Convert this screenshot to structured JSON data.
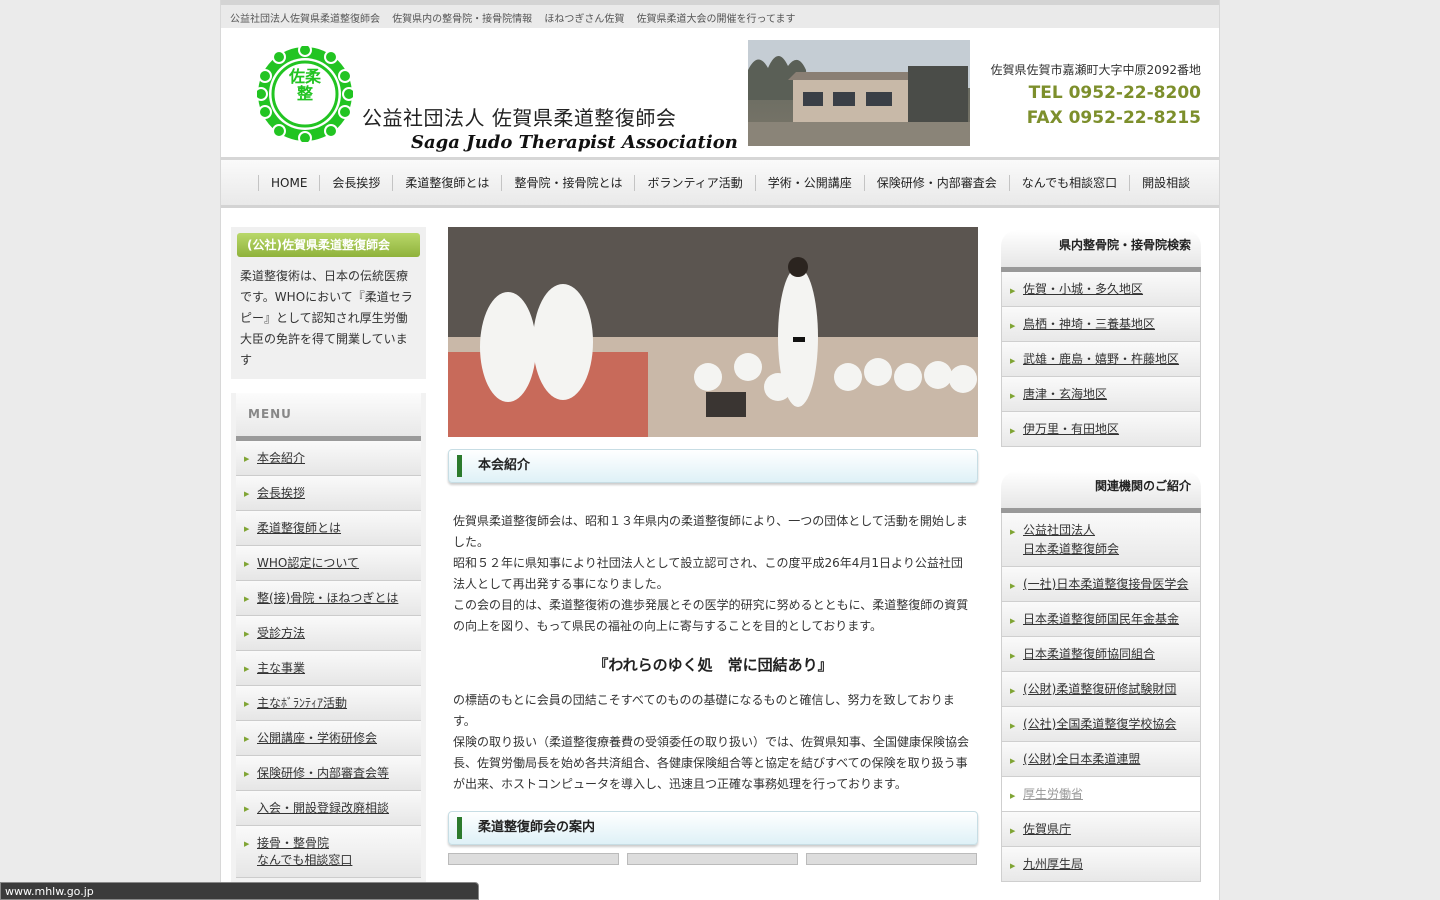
{
  "topbar": {
    "items": [
      "公益社団法人佐賀県柔道整復師会",
      "佐賀県内の整骨院・接骨院情報",
      "ほねつぎさん佐賀",
      "佐賀県柔道大会の開催を行ってます"
    ]
  },
  "header": {
    "emblem_text": "佐柔整",
    "org_name_jp": "公益社団法人 佐賀県柔道整復師会",
    "org_name_en": "Saga Judo Therapist Association",
    "address": "佐賀県佐賀市嘉瀬町大字中原2092番地",
    "tel": "TEL 0952-22-8200",
    "fax": "FAX 0952-22-8215"
  },
  "nav": {
    "items": [
      "HOME",
      "会長挨拶",
      "柔道整復師とは",
      "整骨院・接骨院とは",
      "ボランティア活動",
      "学術・公開講座",
      "保険研修・内部審査会",
      "なんでも相談窓口",
      "開設相談"
    ]
  },
  "sidebar_left": {
    "intro_title": "(公社)佐賀県柔道整復師会",
    "intro_text": "柔道整復術は、日本の伝統医療です。WHOにおいて『柔道セラピー』として認知され厚生労働大臣の免許を得て開業しています",
    "menu_title": "MENU",
    "menu_items": [
      "本会紹介",
      "会長挨拶",
      "柔道整復師とは",
      "WHO認定について",
      "整(接)骨院・ほねつぎとは",
      "受診方法",
      "主な事業",
      "主なﾎﾞﾗﾝﾃｨｱ活動",
      "公開講座・学術研修会",
      "保険研修・内部審査会等",
      "入会・開設登録改廃相談",
      "接骨・整骨院\nなんでも相談窓口"
    ]
  },
  "main": {
    "section1_title": "本会紹介",
    "para1": "佐賀県柔道整復師会は、昭和１３年県内の柔道整復師により、一つの団体として活動を開始しました。",
    "para2": "昭和５２年に県知事により社団法人として設立認可され、この度平成26年4月1日より公益社団法人として再出発する事になりました。",
    "para3": "この会の目的は、柔道整復術の進歩発展とその医学的研究に努めるとともに、柔道整復師の資質の向上を図り、もって県民の福祉の向上に寄与することを目的としております。",
    "motto": "『われらのゆく処　常に団結あり』",
    "para4": "の標語のもとに会員の団結こそすべてのものの基礎になるものと確信し、努力を致しております。",
    "para5": "保険の取り扱い（柔道整復療養費の受領委任の取り扱い）では、佐賀県知事、全国健康保険協会長、佐賀労働局長を始め各共済組合、各健康保険組合等と協定を結びすべての保険を取り扱う事が出来、ホストコンピュータを導入し、迅速且つ正確な事務処理を行っております。",
    "section2_title": "柔道整復師会の案内"
  },
  "sidebar_right": {
    "search_title": "県内整骨院・接骨院検索",
    "search_items": [
      "佐賀・小城・多久地区",
      "鳥栖・神埼・三養基地区",
      "武雄・鹿島・嬉野・杵藤地区",
      "唐津・玄海地区",
      "伊万里・有田地区"
    ],
    "related_title": "関連機関のご紹介",
    "related_items": [
      "公益社団法人\n日本柔道整復師会",
      "(一社)日本柔道整復接骨医学会",
      "日本柔道整復師国民年金基金",
      "日本柔道整復師協同組合",
      "(公財)柔道整復研修試験財団",
      "(公社)全国柔道整復学校協会",
      "(公財)全日本柔道連盟",
      "厚生労働省",
      "佐賀県庁",
      "九州厚生局"
    ]
  },
  "statusbar": {
    "url": "www.mhlw.go.jp"
  },
  "colors": {
    "accent_green": "#7d8f2c",
    "logo_green": "#22c422",
    "menu_bullet": "#7fa433"
  }
}
